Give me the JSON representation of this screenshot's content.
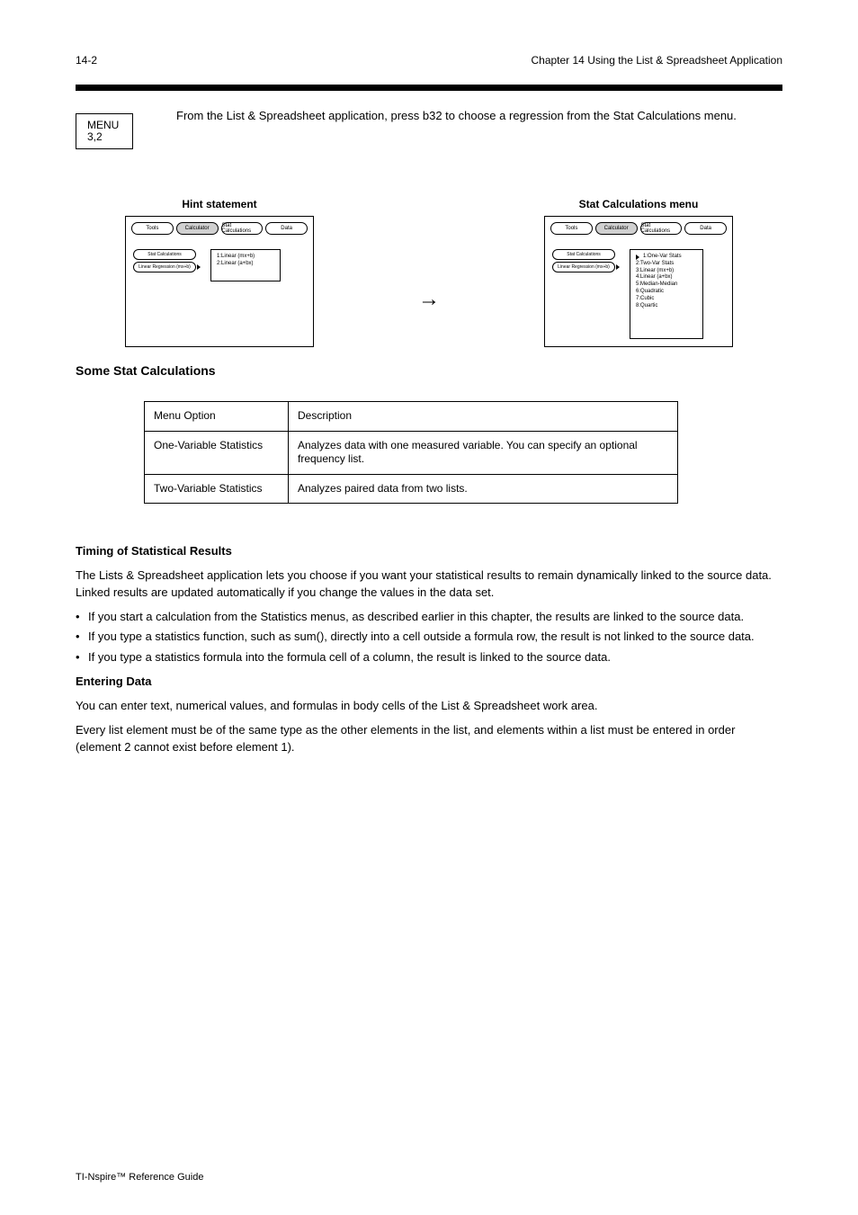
{
  "page_number": "14-2",
  "running_head": "Chapter 14  Using the List & Spreadsheet Application",
  "menu_box": {
    "line1": "MENU",
    "line2": "3,2"
  },
  "intro": "From the List & Spreadsheet application, press b32 to choose a regression from the Stat Calculations menu.",
  "figs": {
    "left_caption": "Hint statement",
    "left_tabs": [
      "Tools",
      "Calculator",
      "Stat Calculations",
      "Data"
    ],
    "left_btns": [
      "Stat Calculations",
      "Linear Regression (mx+b)"
    ],
    "left_panel_lines": [
      "1:Linear (mx+b)",
      "2:Linear (a+bx)"
    ],
    "right_caption": "Stat Calculations menu",
    "right_tabs": [
      "Tools",
      "Calculator",
      "Stat Calculations",
      "Data"
    ],
    "right_btns": [
      "Stat Calculations",
      "Linear Regression (mx+b)"
    ],
    "right_panel_lines": [
      "1:One-Var Stats",
      "2:Two-Var Stats",
      "3:Linear (mx+b)",
      "4:Linear (a+bx)",
      "5:Median-Median",
      "6:Quadratic",
      "7:Cubic",
      "8:Quartic"
    ],
    "arrow": "→"
  },
  "section_title_1": "Some Stat Calculations",
  "table": {
    "rows": [
      [
        "Menu Option",
        "Description"
      ],
      [
        "One-Variable Statistics",
        "Analyzes data with one measured variable. You can specify an optional frequency list."
      ],
      [
        "Two-Variable Statistics",
        "Analyzes paired data from two lists."
      ]
    ]
  },
  "timing_title": "Timing of Statistical Results",
  "timing_p1": "The Lists & Spreadsheet application lets you choose if you want your statistical results to remain dynamically linked to the source data. Linked results are updated automatically if you change the values in the data set.",
  "bullets": [
    "If you start a calculation from the Statistics menus, as described earlier in this chapter, the results are linked to the source data.",
    "If you type a statistics function, such as sum(), directly into a cell outside a formula row, the result is not linked to the source data.",
    "If you type a statistics formula into the formula cell of a column, the result is linked to the source data."
  ],
  "body2_title": "Entering Data",
  "body2_p1": "You can enter text, numerical values, and formulas in body cells of the List & Spreadsheet work area.",
  "body2_p2": "Every list element must be of the same type as the other elements in the list, and elements within a list must be entered in order (element 2 cannot exist before element 1).",
  "footer_note": "TI-Nspire™ Reference Guide"
}
